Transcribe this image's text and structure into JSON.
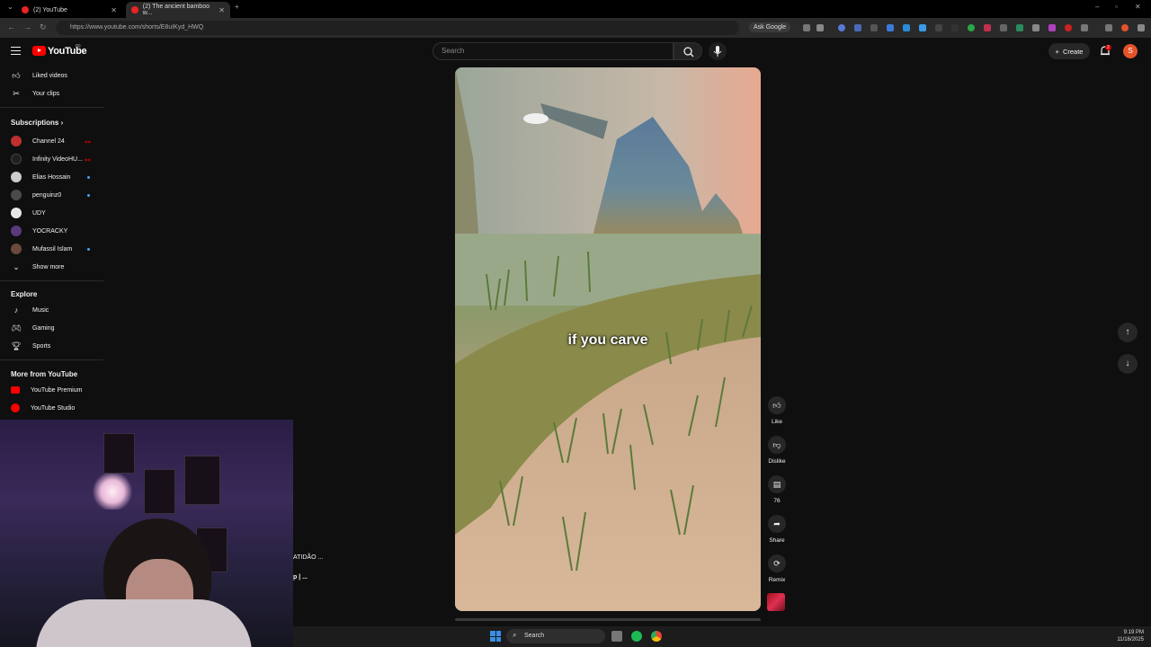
{
  "browser": {
    "tabs": [
      {
        "title": "(2) YouTube"
      },
      {
        "title": "(2) The ancient bamboo w..."
      }
    ],
    "url": "https://www.youtube.com/shorts/E8uIKyd_HWQ",
    "ask_google": "Ask Google"
  },
  "header": {
    "logo_text": "YouTube",
    "logo_badge": "80",
    "search_placeholder": "Search",
    "create_label": "Create",
    "notifications_count": "2",
    "avatar_letter": "S"
  },
  "sidebar": {
    "you_items": [
      {
        "label": "Liked videos",
        "icon": "thumbs-up-icon"
      },
      {
        "label": "Your clips",
        "icon": "scissors-icon"
      }
    ],
    "subscriptions_title": "Subscriptions",
    "subscriptions": [
      {
        "label": "Channel 24",
        "color": "#c03030",
        "indicator": "live"
      },
      {
        "label": "Infinity VideoHU...",
        "color": "#202020",
        "indicator": "live"
      },
      {
        "label": "Elias Hossain",
        "color": "#cccccc",
        "indicator": "dot"
      },
      {
        "label": "penguinz0",
        "color": "#4a4a4a",
        "indicator": "dot"
      },
      {
        "label": "UDY",
        "color": "#e8e8e8",
        "indicator": ""
      },
      {
        "label": "YOCRACKY",
        "color": "#5a3a7a",
        "indicator": ""
      },
      {
        "label": "Mufassil Islam",
        "color": "#6a4a3a",
        "indicator": "dot"
      }
    ],
    "show_more": "Show more",
    "explore_title": "Explore",
    "explore": [
      {
        "label": "Music",
        "icon": "music-note-icon"
      },
      {
        "label": "Gaming",
        "icon": "gamepad-icon"
      },
      {
        "label": "Sports",
        "icon": "trophy-icon"
      }
    ],
    "more_title": "More from YouTube",
    "more": [
      {
        "label": "YouTube Premium"
      },
      {
        "label": "YouTube Studio"
      }
    ]
  },
  "overlay_text": {
    "line1": "ATIDÃO ...",
    "line2": "p | ..."
  },
  "video": {
    "caption": "if you carve"
  },
  "actions": {
    "like": "Like",
    "dislike": "Dislike",
    "comments": "76",
    "share": "Share",
    "remix": "Remix"
  },
  "taskbar": {
    "search": "Search",
    "time": "9:19 PM",
    "date": "11/16/2025"
  },
  "colors": {
    "accent_red": "#ff0000",
    "avatar": "#e5532b",
    "subscription_dot": "#3ea6ff"
  }
}
